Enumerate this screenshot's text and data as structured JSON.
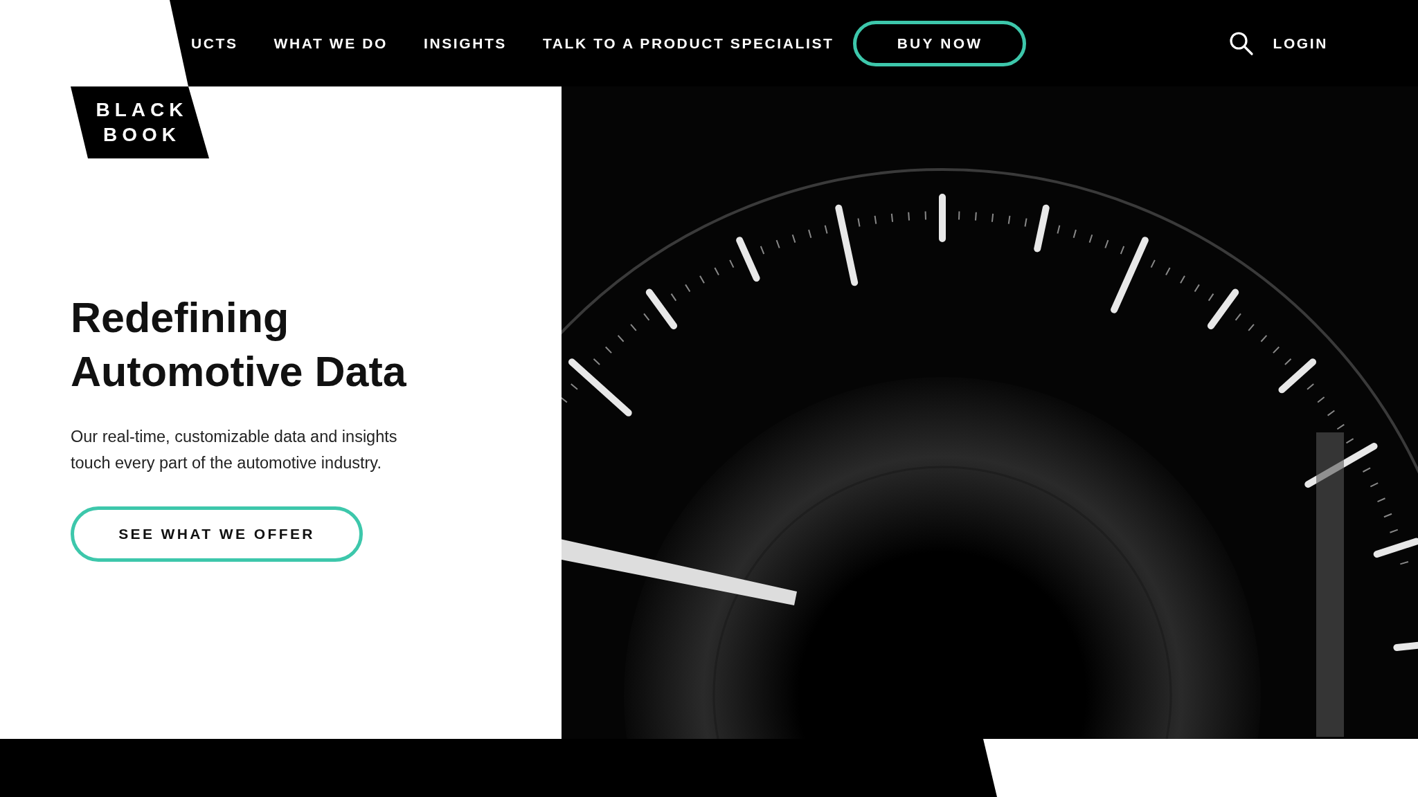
{
  "nav": {
    "items": [
      {
        "label": "UCTS"
      },
      {
        "label": "WHAT WE DO"
      },
      {
        "label": "INSIGHTS"
      },
      {
        "label": "TALK TO A PRODUCT SPECIALIST"
      }
    ],
    "buy_button": "BUY NOW",
    "login": "LOGIN"
  },
  "logo": {
    "lines": [
      "BLACK",
      "BOOK"
    ]
  },
  "hero": {
    "heading_lines": [
      "Redefining",
      "Automotive Data"
    ],
    "text_lines": [
      "Our real-time, customizable data and insights",
      "touch every part of the automotive industry."
    ],
    "cta": "SEE WHAT WE OFFER"
  }
}
